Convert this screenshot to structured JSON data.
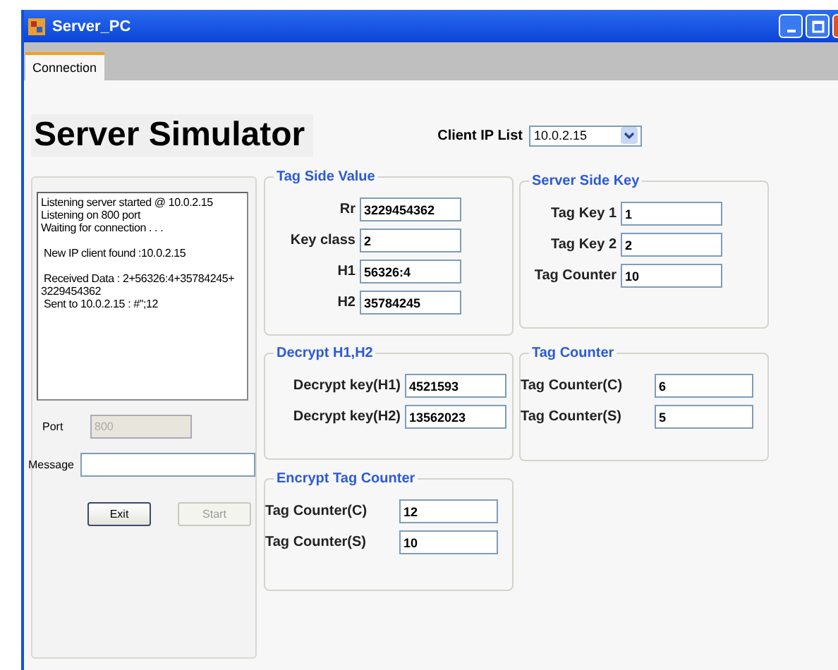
{
  "window": {
    "title": "Server_PC"
  },
  "tabs": [
    {
      "label": "Connection",
      "selected": true
    }
  ],
  "heading": "Server Simulator",
  "client_ip": {
    "label": "Client IP List",
    "value": "10.0.2.15"
  },
  "log": [
    [
      "Listening server started @ 10.0.2.15",
      "Listening on 800 port",
      "Waiting for connection . . ."
    ],
    [
      " New IP client found :10.0.2.15"
    ],
    [
      " Received Data : 2+56326:4+35784245+",
      "3229454362",
      " Sent to 10.0.2.15 : #\";12"
    ]
  ],
  "port": {
    "label": "Port",
    "value": "800",
    "disabled": true
  },
  "message": {
    "label": "Message"
  },
  "buttons": [
    {
      "label": "Exit",
      "disabled": false
    },
    {
      "label": "Start",
      "disabled": true
    }
  ],
  "groups": [
    {
      "title": "Tag Side Value",
      "fields": [
        {
          "label": "Rr",
          "value": "3229454362"
        },
        {
          "label": "Key class",
          "value": "2"
        },
        {
          "label": "H1",
          "value": "56326:4"
        },
        {
          "label": "H2",
          "value": "35784245"
        }
      ]
    },
    {
      "title": "Server Side Key",
      "fields": [
        {
          "label": "Tag Key 1",
          "value": "1"
        },
        {
          "label": "Tag Key 2",
          "value": "2"
        },
        {
          "label": "Tag Counter",
          "value": "10"
        }
      ]
    },
    {
      "title": "Decrypt H1,H2",
      "fields": [
        {
          "label": "Decrypt key(H1)",
          "value": "4521593"
        },
        {
          "label": "Decrypt key(H2)",
          "value": "13562023"
        }
      ]
    },
    {
      "title": "Tag Counter",
      "fields": [
        {
          "label": "Tag Counter(C)",
          "value": "6"
        },
        {
          "label": "Tag Counter(S)",
          "value": "5"
        }
      ]
    },
    {
      "title": "Encrypt Tag Counter",
      "fields": [
        {
          "label": "Tag Counter(C)",
          "value": "12"
        },
        {
          "label": "Tag Counter(S)",
          "value": "10"
        }
      ]
    }
  ]
}
